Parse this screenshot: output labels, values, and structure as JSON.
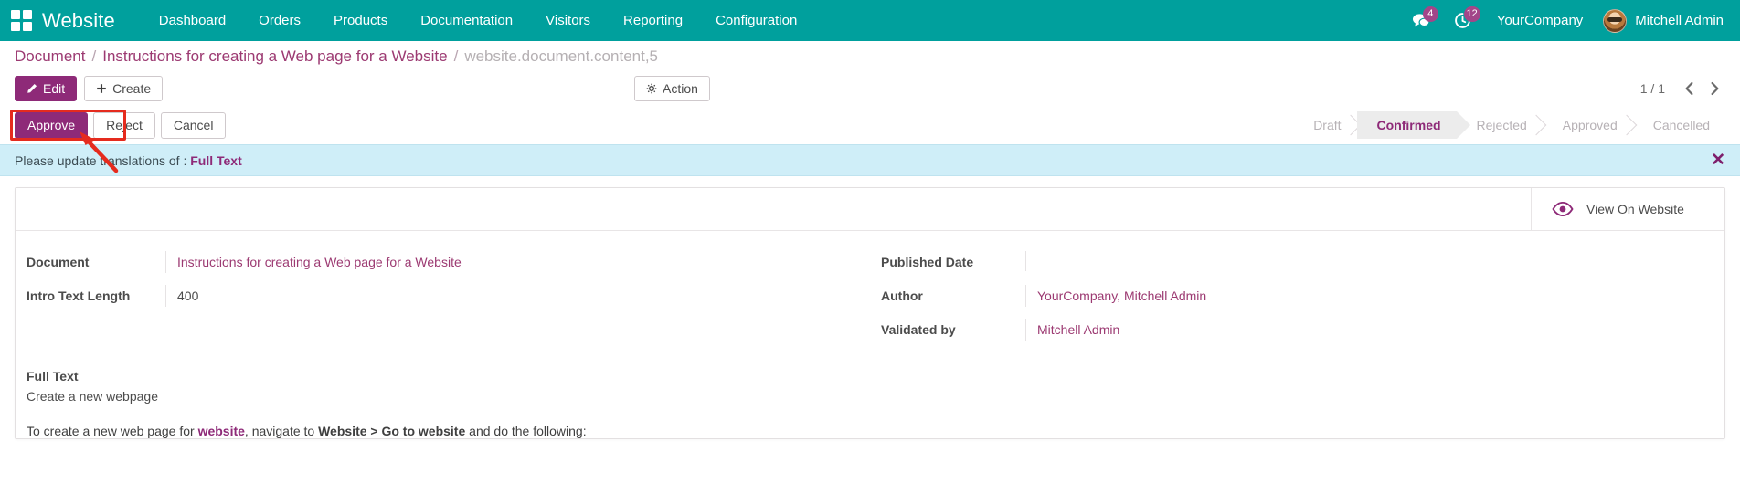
{
  "navbar": {
    "apps_icon": "apps-grid-icon",
    "brand": "Website",
    "items": [
      {
        "label": "Dashboard"
      },
      {
        "label": "Orders"
      },
      {
        "label": "Products"
      },
      {
        "label": "Documentation"
      },
      {
        "label": "Visitors"
      },
      {
        "label": "Reporting"
      },
      {
        "label": "Configuration"
      }
    ],
    "messages_icon": "chat-bubble-icon",
    "messages_count": "4",
    "activity_icon": "clock-icon",
    "activity_count": "12",
    "company": "YourCompany",
    "user": "Mitchell Admin",
    "accent": "#00a09d"
  },
  "breadcrumb": {
    "root": "Document",
    "parent": "Instructions for creating a Web page for a Website",
    "current": "website.document.content,5",
    "separator": "/"
  },
  "control_panel": {
    "edit_label": "Edit",
    "edit_icon": "pencil-icon",
    "create_label": "Create",
    "create_icon": "plus-icon",
    "action_label": "Action",
    "action_icon": "gear-icon",
    "pager_value": "1 / 1",
    "prev_icon": "chevron-left-icon",
    "next_icon": "chevron-right-icon"
  },
  "workflow": {
    "buttons": [
      {
        "label": "Approve",
        "style": "primary"
      },
      {
        "label": "Reject",
        "style": "secondary"
      },
      {
        "label": "Cancel",
        "style": "secondary"
      }
    ],
    "statuses": [
      {
        "label": "Draft",
        "active": false
      },
      {
        "label": "Confirmed",
        "active": true
      },
      {
        "label": "Rejected",
        "active": false
      },
      {
        "label": "Approved",
        "active": false
      },
      {
        "label": "Cancelled",
        "active": false
      }
    ],
    "active_color": "#8e2a78"
  },
  "alert": {
    "text": "Please update translations of : ",
    "highlight": "Full Text",
    "close_icon": "close-icon",
    "background": "#cfeef8"
  },
  "smart_button": {
    "icon": "eye-icon",
    "label": "View On Website"
  },
  "form": {
    "left": [
      {
        "label": "Document",
        "value": "Instructions for creating a Web page for a Website",
        "is_link": true
      },
      {
        "label": "Intro Text Length",
        "value": "400",
        "is_link": false
      }
    ],
    "right": [
      {
        "label": "Published Date",
        "value": "",
        "is_link": false
      },
      {
        "label": "Author",
        "value": "YourCompany, Mitchell Admin",
        "is_link": true
      },
      {
        "label": "Validated by",
        "value": "Mitchell Admin",
        "is_link": true
      }
    ]
  },
  "full_text": {
    "title": "Full Text",
    "subtitle": "Create a new webpage",
    "paragraph_start": "To create a new web page for ",
    "paragraph_link": "website",
    "paragraph_mid": ", navigate to ",
    "paragraph_bold": "Website > Go to website",
    "paragraph_end": " and do the following:"
  }
}
